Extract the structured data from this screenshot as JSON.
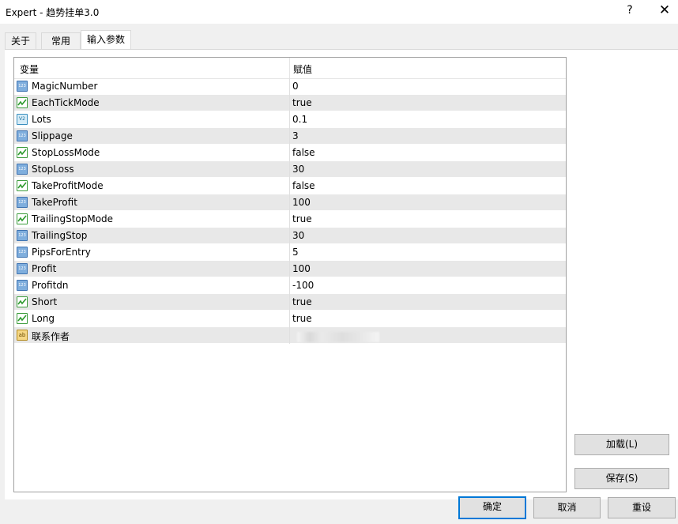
{
  "window": {
    "title": "Expert - 趋势挂单3.0",
    "help_glyph": "?",
    "close_glyph": "✕"
  },
  "tabs": [
    {
      "label": "关于",
      "active": false
    },
    {
      "label": "常用",
      "active": false
    },
    {
      "label": "输入参数",
      "active": true
    }
  ],
  "grid": {
    "col_variable": "变量",
    "col_value": "赋值",
    "rows": [
      {
        "name": "MagicNumber",
        "value": "0",
        "icon": "int-icon"
      },
      {
        "name": "EachTickMode",
        "value": "true",
        "icon": "bool-icon"
      },
      {
        "name": "Lots",
        "value": "0.1",
        "icon": "double-icon"
      },
      {
        "name": "Slippage",
        "value": "3",
        "icon": "int-icon"
      },
      {
        "name": "StopLossMode",
        "value": "false",
        "icon": "bool-icon"
      },
      {
        "name": "StopLoss",
        "value": "30",
        "icon": "int-icon"
      },
      {
        "name": "TakeProfitMode",
        "value": "false",
        "icon": "bool-icon"
      },
      {
        "name": "TakeProfit",
        "value": "100",
        "icon": "int-icon"
      },
      {
        "name": "TrailingStopMode",
        "value": "true",
        "icon": "bool-icon"
      },
      {
        "name": "TrailingStop",
        "value": "30",
        "icon": "int-icon"
      },
      {
        "name": "PipsForEntry",
        "value": "5",
        "icon": "int-icon"
      },
      {
        "name": "Profit",
        "value": "100",
        "icon": "int-icon"
      },
      {
        "name": "Profitdn",
        "value": "-100",
        "icon": "int-icon"
      },
      {
        "name": "Short",
        "value": "true",
        "icon": "bool-icon"
      },
      {
        "name": "Long",
        "value": "true",
        "icon": "bool-icon"
      },
      {
        "name": "联系作者",
        "value": "",
        "icon": "string-icon"
      }
    ]
  },
  "side_buttons": {
    "load": "加载(L)",
    "save": "保存(S)"
  },
  "footer_buttons": {
    "ok": "确定",
    "cancel": "取消",
    "reset": "重设"
  }
}
